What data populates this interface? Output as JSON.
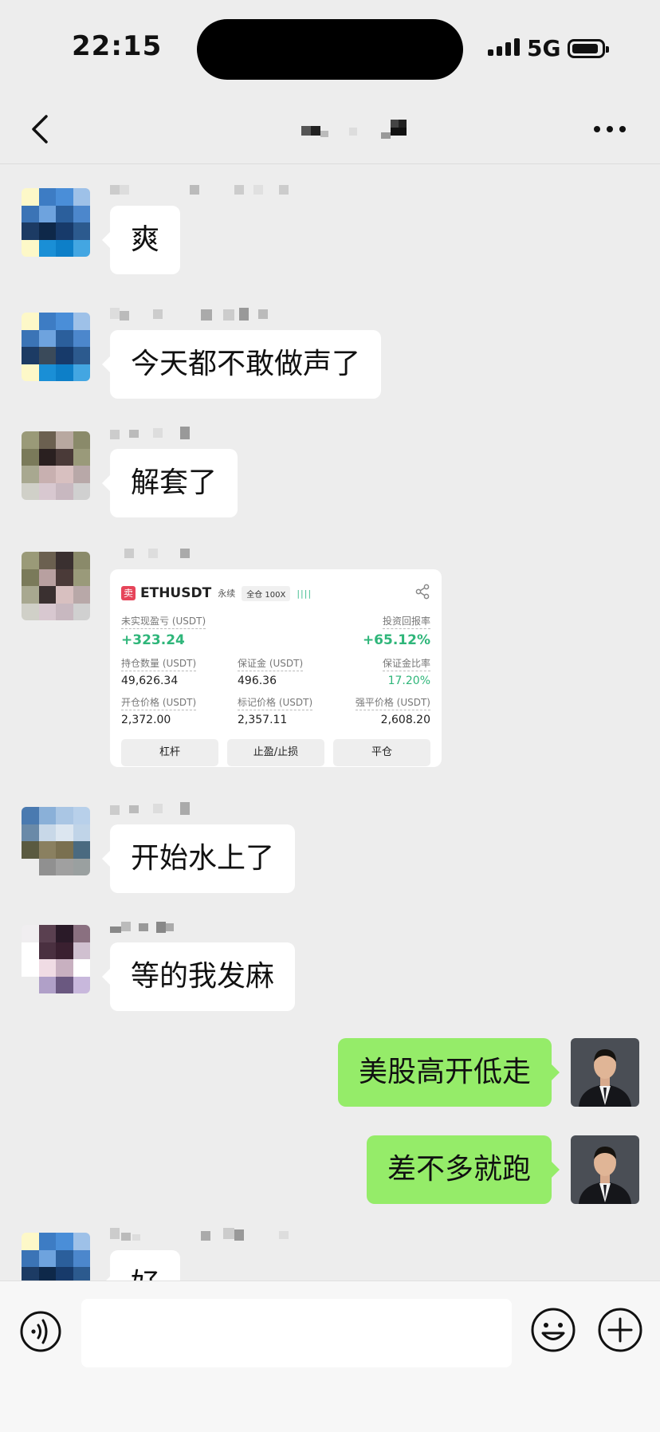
{
  "status_bar": {
    "time": "22:15",
    "network": "5G"
  },
  "colors": {
    "sent_bubble": "#95ec69",
    "profit_green": "#2fb67a",
    "sell_red": "#e6455a",
    "chat_bg": "#ededed"
  },
  "messages": [
    {
      "side": "left",
      "text": "爽"
    },
    {
      "side": "left",
      "text": "今天都不敢做声了"
    },
    {
      "side": "left",
      "text": "解套了"
    },
    {
      "side": "left",
      "type": "trade-card"
    },
    {
      "side": "left",
      "text": "开始水上了"
    },
    {
      "side": "left",
      "text": "等的我发麻"
    },
    {
      "side": "right",
      "text": "美股高开低走"
    },
    {
      "side": "right",
      "text": "差不多就跑"
    },
    {
      "side": "left",
      "text": "好"
    }
  ],
  "trade_card": {
    "badge": "卖",
    "symbol": "ETHUSDT",
    "contract_type": "永续",
    "leverage": "全仓 100X",
    "bars": "||||",
    "pnl_label": "未实现盈亏 (USDT)",
    "pnl_value": "+323.24",
    "roi_label": "投资回报率",
    "roi_value": "+65.12%",
    "size_label": "持仓数量 (USDT)",
    "size_value": "49,626.34",
    "margin_label": "保证金 (USDT)",
    "margin_value": "496.36",
    "margin_ratio_label": "保证金比率",
    "margin_ratio_value": "17.20%",
    "entry_label": "开仓价格 (USDT)",
    "entry_value": "2,372.00",
    "mark_label": "标记价格 (USDT)",
    "mark_value": "2,357.11",
    "liq_label": "强平价格 (USDT)",
    "liq_value": "2,608.20",
    "buttons": [
      "杠杆",
      "止盈/止损",
      "平仓"
    ]
  },
  "icons": [
    "back-arrow-icon",
    "more-icon",
    "share-icon",
    "voice-icon",
    "emoji-icon",
    "plus-icon"
  ]
}
